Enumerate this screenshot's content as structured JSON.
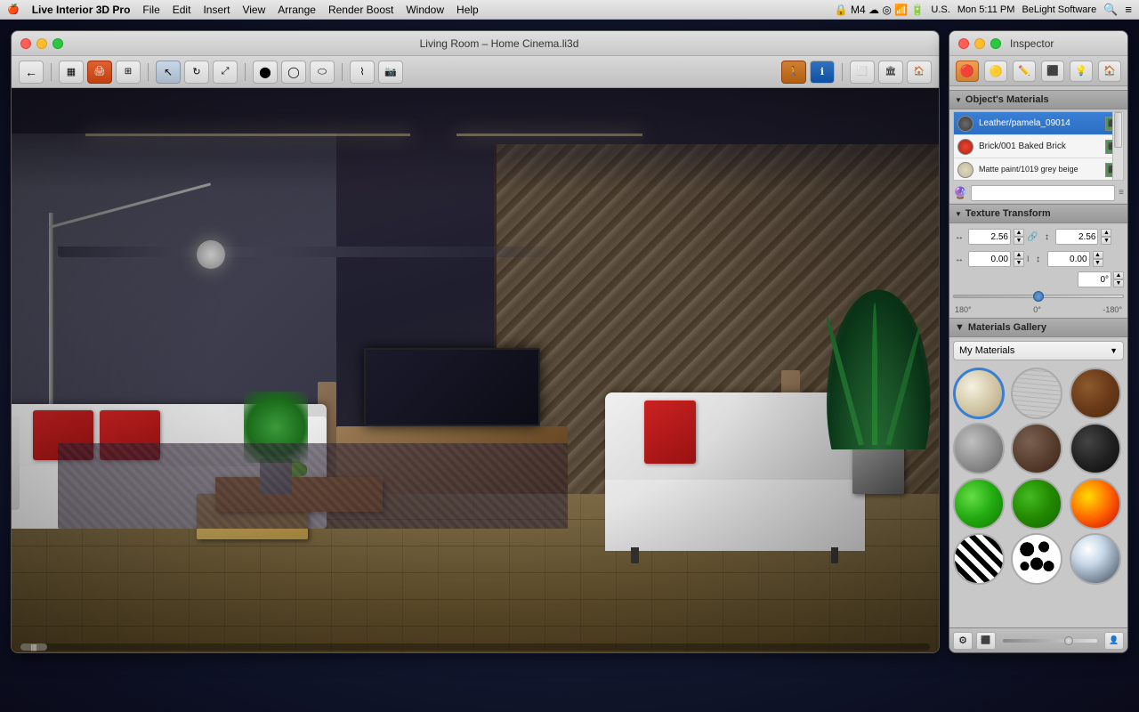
{
  "menubar": {
    "apple": "🍎",
    "app_name": "Live Interior 3D Pro",
    "items": [
      "File",
      "Edit",
      "Insert",
      "View",
      "Arrange",
      "Render Boost",
      "Window",
      "Help"
    ],
    "right": {
      "time": "Mon 5:11 PM",
      "company": "BeLight Software"
    }
  },
  "main_window": {
    "title": "Living Room – Home Cinema.li3d",
    "traffic_lights": {
      "close": "close",
      "minimize": "minimize",
      "maximize": "maximize"
    },
    "toolbar_buttons": [
      {
        "name": "back",
        "icon": "←",
        "tooltip": "Back"
      },
      {
        "name": "floor-plan",
        "icon": "▦",
        "tooltip": "Floor Plan"
      },
      {
        "name": "render",
        "icon": "📷",
        "tooltip": "Render"
      },
      {
        "name": "view3d",
        "icon": "🏠",
        "tooltip": "3D View"
      },
      {
        "name": "select",
        "icon": "↖",
        "tooltip": "Select"
      },
      {
        "name": "rotate",
        "icon": "↻",
        "tooltip": "Rotate"
      },
      {
        "name": "move",
        "icon": "✛",
        "tooltip": "Move"
      },
      {
        "name": "sphere",
        "icon": "⬤",
        "tooltip": "Sphere"
      },
      {
        "name": "ring",
        "icon": "◯",
        "tooltip": "Ring"
      },
      {
        "name": "cylinder",
        "icon": "⬭",
        "tooltip": "Cylinder"
      },
      {
        "name": "measure",
        "icon": "📐",
        "tooltip": "Measure"
      },
      {
        "name": "camera",
        "icon": "📸",
        "tooltip": "Camera"
      },
      {
        "name": "walk",
        "icon": "🚶",
        "tooltip": "Walk"
      },
      {
        "name": "info",
        "icon": "ℹ",
        "tooltip": "Info"
      },
      {
        "name": "wall-view",
        "icon": "⬜",
        "tooltip": "Wall View"
      },
      {
        "name": "interior-view",
        "icon": "🏠",
        "tooltip": "Interior View"
      },
      {
        "name": "exterior-view",
        "icon": "🏠",
        "tooltip": "Exterior View"
      }
    ]
  },
  "inspector": {
    "title": "Inspector",
    "tabs": [
      {
        "name": "materials",
        "icon": "🔴",
        "active": true
      },
      {
        "name": "object",
        "icon": "🔵",
        "active": false
      },
      {
        "name": "edit",
        "icon": "✏",
        "active": false
      },
      {
        "name": "texture",
        "icon": "🔲",
        "active": false
      },
      {
        "name": "light",
        "icon": "💡",
        "active": false
      },
      {
        "name": "home",
        "icon": "🏠",
        "active": false
      }
    ],
    "objects_materials": {
      "section_label": "Object's Materials",
      "materials": [
        {
          "name": "Leather/pamela_09014",
          "swatch_color": "#4a4a4a",
          "selected": true
        },
        {
          "name": "Brick/001 Baked Brick",
          "swatch_color": "#cc3322",
          "selected": false
        },
        {
          "name": "Matte paint/1019 grey beige",
          "swatch_color": "#d4c8b0",
          "selected": false
        }
      ]
    },
    "texture_transform": {
      "section_label": "Texture Transform",
      "scale_x_label": "↔",
      "scale_x_value": "2.56",
      "scale_y_label": "↕",
      "scale_y_value": "2.56",
      "offset_x_label": "↔",
      "offset_x_value": "0.00",
      "offset_y_label": "↕",
      "offset_y_value": "0.00",
      "rotation_value": "0°",
      "rotation_label_left": "180°",
      "rotation_label_center": "0°",
      "rotation_label_right": "-180°"
    },
    "materials_gallery": {
      "section_label": "Materials Gallery",
      "dropdown_label": "My Materials",
      "spheres": [
        {
          "name": "cream",
          "class": "sphere-cream",
          "selected": true
        },
        {
          "name": "wood",
          "class": "sphere-wood",
          "selected": false
        },
        {
          "name": "brown-brick",
          "class": "sphere-brown",
          "selected": false
        },
        {
          "name": "metal-light",
          "class": "sphere-metal-light",
          "selected": false
        },
        {
          "name": "metal-dark",
          "class": "sphere-metal-dark",
          "selected": false
        },
        {
          "name": "black",
          "class": "sphere-black",
          "selected": false
        },
        {
          "name": "green-bright",
          "class": "sphere-green-bright",
          "selected": false
        },
        {
          "name": "green-dark",
          "class": "sphere-green-dark",
          "selected": false
        },
        {
          "name": "fire",
          "class": "sphere-fire",
          "selected": false
        },
        {
          "name": "zebra",
          "class": "sphere-zebra",
          "selected": false
        },
        {
          "name": "spots",
          "class": "sphere-spots",
          "selected": false
        },
        {
          "name": "chrome",
          "class": "sphere-chrome",
          "selected": false
        }
      ]
    }
  }
}
